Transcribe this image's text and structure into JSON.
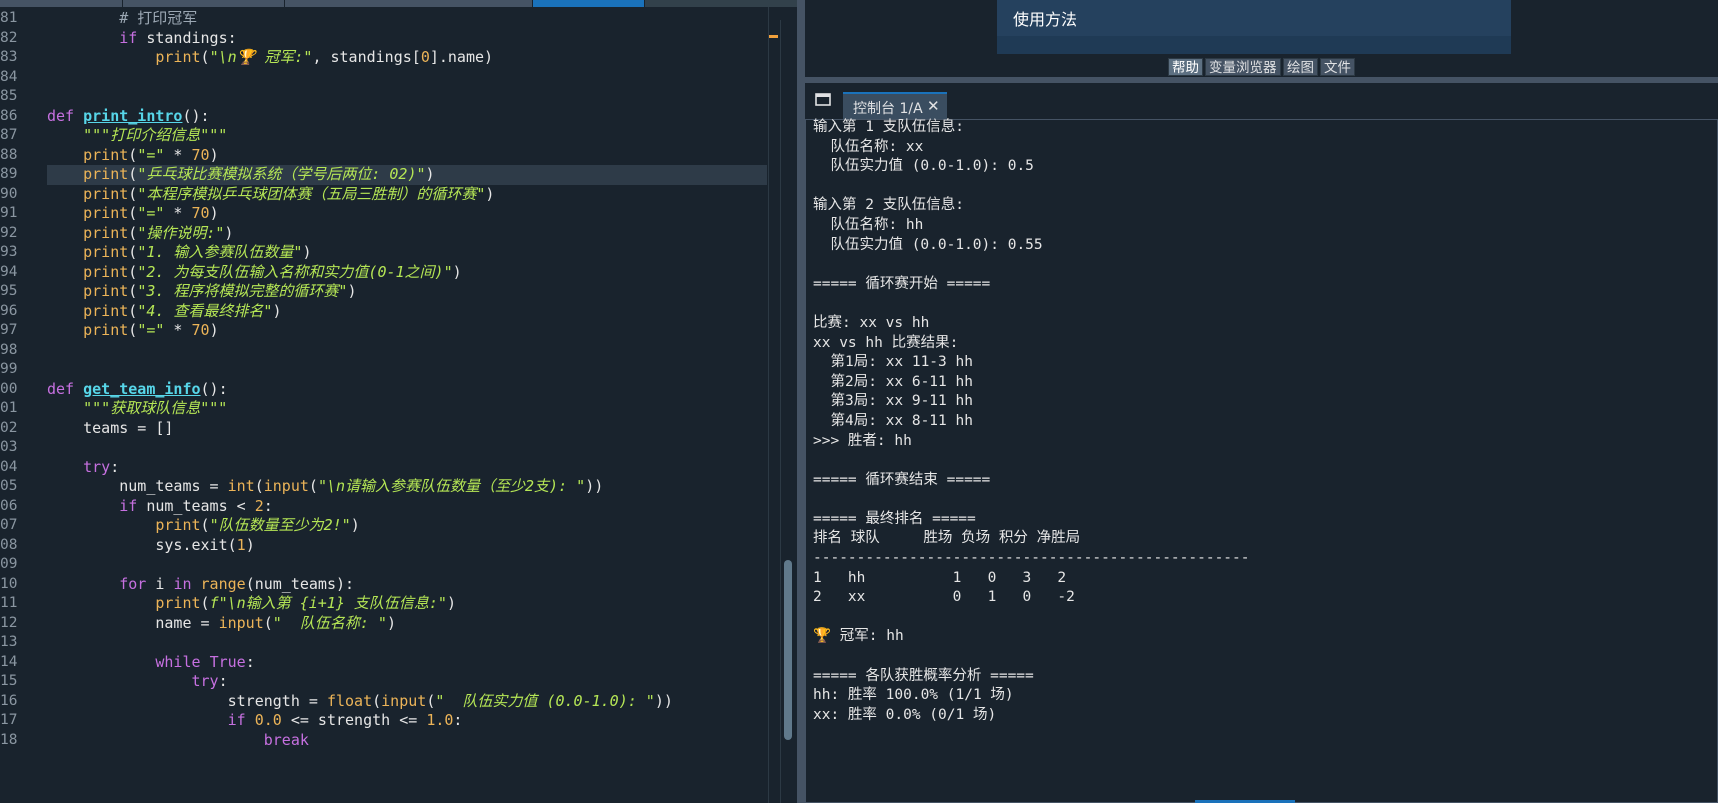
{
  "editor": {
    "lines": [
      {
        "n": "81",
        "tokens": [
          [
            "cm",
            "        # 打印冠军"
          ]
        ]
      },
      {
        "n": "82",
        "tokens": [
          [
            "kw",
            "        if"
          ],
          [
            "op",
            " standings:"
          ]
        ]
      },
      {
        "n": "83",
        "tokens": [
          [
            "bi",
            "            print"
          ],
          [
            "op",
            "("
          ],
          [
            "st",
            "\"\\n🏆 冠军:\""
          ],
          [
            "op",
            ", standings["
          ],
          [
            "nm",
            "0"
          ],
          [
            "op",
            "].name)"
          ]
        ]
      },
      {
        "n": "84",
        "tokens": []
      },
      {
        "n": "85",
        "tokens": []
      },
      {
        "n": "86",
        "tokens": [
          [
            "kw",
            "def "
          ],
          [
            "fn",
            "print_intro"
          ],
          [
            "op",
            "():"
          ]
        ]
      },
      {
        "n": "87",
        "tokens": [
          [
            "st",
            "    \"\"\"打印介绍信息\"\"\""
          ]
        ]
      },
      {
        "n": "88",
        "tokens": [
          [
            "bi",
            "    print"
          ],
          [
            "op",
            "("
          ],
          [
            "st",
            "\"=\""
          ],
          [
            "op",
            " * "
          ],
          [
            "nm",
            "70"
          ],
          [
            "op",
            ")"
          ]
        ]
      },
      {
        "n": "89",
        "hl": true,
        "tokens": [
          [
            "bi",
            "    print"
          ],
          [
            "op",
            "("
          ],
          [
            "st",
            "\"乒乓球比赛模拟系统（学号后两位: 02)\""
          ],
          [
            "op",
            ")"
          ]
        ]
      },
      {
        "n": "90",
        "tokens": [
          [
            "bi",
            "    print"
          ],
          [
            "op",
            "("
          ],
          [
            "st",
            "\"本程序模拟乒乓球团体赛（五局三胜制）的循环赛\""
          ],
          [
            "op",
            ")"
          ]
        ]
      },
      {
        "n": "91",
        "tokens": [
          [
            "bi",
            "    print"
          ],
          [
            "op",
            "("
          ],
          [
            "st",
            "\"=\""
          ],
          [
            "op",
            " * "
          ],
          [
            "nm",
            "70"
          ],
          [
            "op",
            ")"
          ]
        ]
      },
      {
        "n": "92",
        "tokens": [
          [
            "bi",
            "    print"
          ],
          [
            "op",
            "("
          ],
          [
            "st",
            "\"操作说明:\""
          ],
          [
            "op",
            ")"
          ]
        ]
      },
      {
        "n": "93",
        "tokens": [
          [
            "bi",
            "    print"
          ],
          [
            "op",
            "("
          ],
          [
            "st",
            "\"1. 输入参赛队伍数量\""
          ],
          [
            "op",
            ")"
          ]
        ]
      },
      {
        "n": "94",
        "tokens": [
          [
            "bi",
            "    print"
          ],
          [
            "op",
            "("
          ],
          [
            "st",
            "\"2. 为每支队伍输入名称和实力值(0-1之间)\""
          ],
          [
            "op",
            ")"
          ]
        ]
      },
      {
        "n": "95",
        "tokens": [
          [
            "bi",
            "    print"
          ],
          [
            "op",
            "("
          ],
          [
            "st",
            "\"3. 程序将模拟完整的循环赛\""
          ],
          [
            "op",
            ")"
          ]
        ]
      },
      {
        "n": "96",
        "tokens": [
          [
            "bi",
            "    print"
          ],
          [
            "op",
            "("
          ],
          [
            "st",
            "\"4. 查看最终排名\""
          ],
          [
            "op",
            ")"
          ]
        ]
      },
      {
        "n": "97",
        "tokens": [
          [
            "bi",
            "    print"
          ],
          [
            "op",
            "("
          ],
          [
            "st",
            "\"=\""
          ],
          [
            "op",
            " * "
          ],
          [
            "nm",
            "70"
          ],
          [
            "op",
            ")"
          ]
        ]
      },
      {
        "n": "98",
        "tokens": []
      },
      {
        "n": "99",
        "tokens": []
      },
      {
        "n": "00",
        "tokens": [
          [
            "kw",
            "def "
          ],
          [
            "fn",
            "get_team_info"
          ],
          [
            "op",
            "():"
          ]
        ]
      },
      {
        "n": "01",
        "tokens": [
          [
            "st",
            "    \"\"\"获取球队信息\"\"\""
          ]
        ]
      },
      {
        "n": "02",
        "tokens": [
          [
            "op",
            "    teams = []"
          ]
        ]
      },
      {
        "n": "03",
        "tokens": []
      },
      {
        "n": "04",
        "tokens": [
          [
            "kw",
            "    try"
          ],
          [
            "op",
            ":"
          ]
        ]
      },
      {
        "n": "05",
        "tokens": [
          [
            "op",
            "        num_teams = "
          ],
          [
            "bi",
            "int"
          ],
          [
            "op",
            "("
          ],
          [
            "bi",
            "input"
          ],
          [
            "op",
            "("
          ],
          [
            "st",
            "\"\\n请输入参赛队伍数量（至少2支): \""
          ],
          [
            "op",
            "))"
          ]
        ]
      },
      {
        "n": "06",
        "tokens": [
          [
            "kw",
            "        if"
          ],
          [
            "op",
            " num_teams < "
          ],
          [
            "nm",
            "2"
          ],
          [
            "op",
            ":"
          ]
        ]
      },
      {
        "n": "07",
        "tokens": [
          [
            "bi",
            "            print"
          ],
          [
            "op",
            "("
          ],
          [
            "st",
            "\"队伍数量至少为2!\""
          ],
          [
            "op",
            ")"
          ]
        ]
      },
      {
        "n": "08",
        "tokens": [
          [
            "op",
            "            sys.exit("
          ],
          [
            "nm",
            "1"
          ],
          [
            "op",
            ")"
          ]
        ]
      },
      {
        "n": "09",
        "tokens": []
      },
      {
        "n": "10",
        "tokens": [
          [
            "kw",
            "        for"
          ],
          [
            "op",
            " i "
          ],
          [
            "kw",
            "in"
          ],
          [
            "op",
            " "
          ],
          [
            "bi",
            "range"
          ],
          [
            "op",
            "(num_teams):"
          ]
        ]
      },
      {
        "n": "11",
        "tokens": [
          [
            "bi",
            "            print"
          ],
          [
            "op",
            "("
          ],
          [
            "st",
            "f\"\\n输入第 {i+1} 支队伍信息:\""
          ],
          [
            "op",
            ")"
          ]
        ]
      },
      {
        "n": "12",
        "tokens": [
          [
            "op",
            "            name = "
          ],
          [
            "bi",
            "input"
          ],
          [
            "op",
            "("
          ],
          [
            "st",
            "\"  队伍名称: \""
          ],
          [
            "op",
            ")"
          ]
        ]
      },
      {
        "n": "13",
        "tokens": []
      },
      {
        "n": "14",
        "tokens": [
          [
            "kw",
            "            while"
          ],
          [
            "op",
            " "
          ],
          [
            "kw",
            "True"
          ],
          [
            "op",
            ":"
          ]
        ]
      },
      {
        "n": "15",
        "tokens": [
          [
            "kw",
            "                try"
          ],
          [
            "op",
            ":"
          ]
        ]
      },
      {
        "n": "16",
        "tokens": [
          [
            "op",
            "                    strength = "
          ],
          [
            "bi",
            "float"
          ],
          [
            "op",
            "("
          ],
          [
            "bi",
            "input"
          ],
          [
            "op",
            "("
          ],
          [
            "st",
            "\"  队伍实力值 (0.0-1.0): \""
          ],
          [
            "op",
            "))"
          ]
        ]
      },
      {
        "n": "17",
        "tokens": [
          [
            "kw",
            "                    if"
          ],
          [
            "op",
            " "
          ],
          [
            "nm",
            "0.0"
          ],
          [
            "op",
            " <= strength <= "
          ],
          [
            "nm",
            "1.0"
          ],
          [
            "op",
            ":"
          ]
        ]
      },
      {
        "n": "18",
        "tokens": [
          [
            "kw",
            "                        break"
          ]
        ]
      }
    ]
  },
  "help": {
    "title": "使用方法"
  },
  "pane_tabs": [
    "帮助",
    "变量浏览器",
    "绘图",
    "文件"
  ],
  "console": {
    "tab_label": "控制台 1/A",
    "lines": [
      "输入第 1 支队伍信息:",
      "  队伍名称: xx",
      "  队伍实力值 (0.0-1.0): 0.5",
      "",
      "输入第 2 支队伍信息:",
      "  队伍名称: hh",
      "  队伍实力值 (0.0-1.0): 0.55",
      "",
      "===== 循环赛开始 =====",
      "",
      "比赛: xx vs hh",
      "xx vs hh 比赛结果:",
      "  第1局: xx 11-3 hh",
      "  第2局: xx 6-11 hh",
      "  第3局: xx 9-11 hh",
      "  第4局: xx 8-11 hh",
      ">>> 胜者: hh",
      "",
      "===== 循环赛结束 =====",
      "",
      "===== 最终排名 =====",
      "排名 球队     胜场 负场 积分 净胜局",
      "--------------------------------------------------",
      "1   hh          1   0   3   2",
      "2   xx          0   1   0   -2",
      "",
      "🏆 冠军: hh",
      "",
      "===== 各队获胜概率分析 =====",
      "hh: 胜率 100.0% (1/1 场)",
      "xx: 胜率 0.0% (0/1 场)"
    ]
  },
  "colors": {
    "background": "#19232d",
    "accent": "#1a72bb",
    "keyword": "#c670e0",
    "function": "#57d6e9",
    "builtin": "#ecb458",
    "string": "#b5e655"
  }
}
